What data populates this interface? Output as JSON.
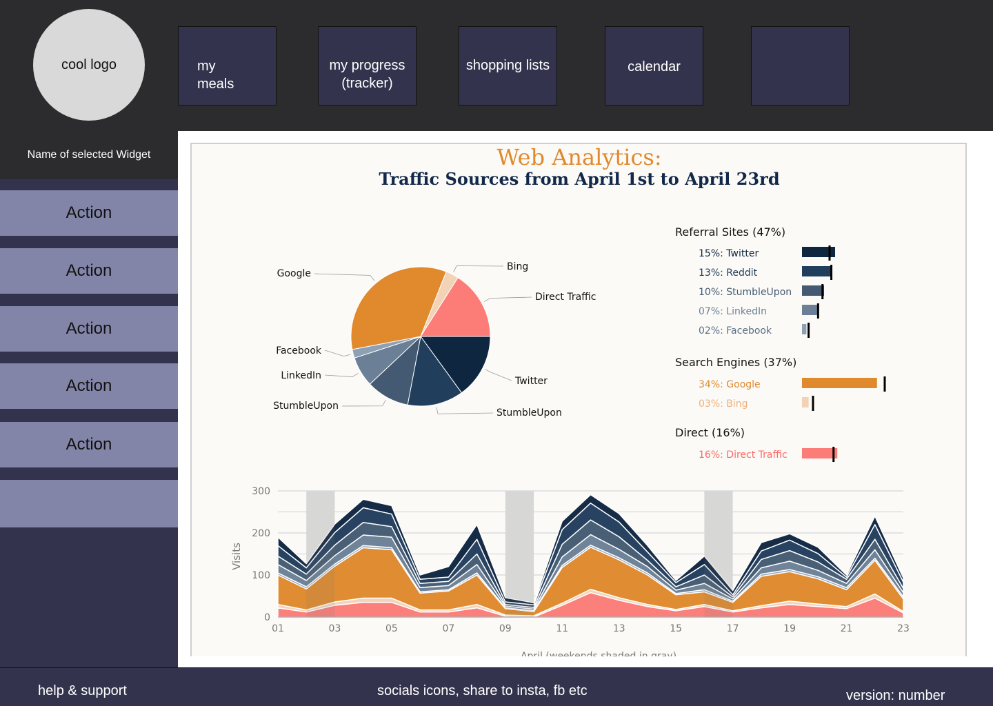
{
  "header": {
    "logo_text": "cool logo",
    "nav": [
      {
        "label": "my\nmeals"
      },
      {
        "label": "my progress\n(tracker)"
      },
      {
        "label": "shopping lists"
      },
      {
        "label": "calendar"
      },
      {
        "label": ""
      }
    ]
  },
  "sidebar": {
    "widget_name": "Name of selected Widget",
    "actions": [
      "Action",
      "Action",
      "Action",
      "Action",
      "Action"
    ]
  },
  "colors": {
    "twitter": "#0f2641",
    "reddit": "#213e5d",
    "stumbleupon": "#445a72",
    "linkedin": "#6b8096",
    "facebook": "#8ea0b4",
    "google": "#e0892d",
    "bing": "#f3d3b6",
    "direct": "#fc7c78"
  },
  "chart_data": [
    {
      "type": "pie",
      "title": "Web Analytics:",
      "subtitle": "Traffic Sources from April 1st to April 23rd",
      "slices": [
        {
          "label": "Twitter",
          "value": 15,
          "color": "#0f2641"
        },
        {
          "label": "StumbleUpon",
          "value": 13,
          "color": "#213e5d"
        },
        {
          "label": "StumbleUpon",
          "value": 10,
          "color": "#445a72"
        },
        {
          "label": "LinkedIn",
          "value": 7,
          "color": "#6b8096"
        },
        {
          "label": "Facebook",
          "value": 2,
          "color": "#8ea0b4"
        },
        {
          "label": "Google",
          "value": 34,
          "color": "#e0892d"
        },
        {
          "label": "Bing",
          "value": 3,
          "color": "#f3d3b6"
        },
        {
          "label": "Direct Traffic",
          "value": 16,
          "color": "#fc7c78"
        }
      ]
    },
    {
      "type": "bar",
      "groups": [
        {
          "title": "Referral Sites (47%)",
          "items": [
            {
              "label": "15%: Twitter",
              "value": 15,
              "target": 12.5,
              "color": "#0f2641"
            },
            {
              "label": "13%: Reddit",
              "value": 13,
              "target": 13.3,
              "color": "#213e5d"
            },
            {
              "label": "10%: StumbleUpon",
              "value": 10,
              "target": 9.3,
              "color": "#445a72"
            },
            {
              "label": "07%: LinkedIn",
              "value": 7,
              "target": 7.3,
              "color": "#6b8096"
            },
            {
              "label": "02%: Facebook",
              "value": 2,
              "target": 3,
              "color": "#8ea0b4"
            }
          ]
        },
        {
          "title": "Search Engines (37%)",
          "items": [
            {
              "label": "34%: Google",
              "value": 34,
              "target": 37.5,
              "color": "#e0892d"
            },
            {
              "label": "03%: Bing",
              "value": 3,
              "target": 5,
              "color": "#f3d3b6"
            }
          ]
        },
        {
          "title": "Direct (16%)",
          "items": [
            {
              "label": "16%: Direct Traffic",
              "value": 16,
              "target": 14.3,
              "color": "#fc7c78"
            }
          ]
        }
      ]
    },
    {
      "type": "area",
      "ylabel": "Visits",
      "xlabel": "April (weekends shaded in gray)",
      "ylim": [
        0,
        300
      ],
      "yticks": [
        0,
        100,
        200,
        300
      ],
      "xticks": [
        "01",
        "03",
        "05",
        "07",
        "09",
        "11",
        "13",
        "15",
        "17",
        "19",
        "21",
        "23"
      ],
      "x": [
        1,
        2,
        3,
        4,
        5,
        6,
        7,
        8,
        9,
        10,
        11,
        12,
        13,
        14,
        15,
        16,
        17,
        18,
        19,
        20,
        21,
        22,
        23
      ],
      "weekends": [
        [
          2,
          3
        ],
        [
          9,
          10
        ],
        [
          16,
          17
        ]
      ],
      "series": [
        {
          "name": "Direct Traffic",
          "color": "#fc7c78",
          "values": [
            22,
            12,
            28,
            35,
            35,
            12,
            12,
            22,
            2,
            0,
            28,
            58,
            40,
            25,
            15,
            25,
            12,
            22,
            30,
            25,
            20,
            45,
            10
          ]
        },
        {
          "name": "Bing",
          "color": "#f3d3b6",
          "values": [
            8,
            5,
            8,
            10,
            10,
            5,
            5,
            8,
            3,
            3,
            5,
            8,
            6,
            5,
            3,
            5,
            3,
            5,
            8,
            6,
            5,
            10,
            3
          ]
        },
        {
          "name": "Google",
          "color": "#e0892d",
          "values": [
            70,
            50,
            85,
            120,
            115,
            40,
            45,
            70,
            15,
            10,
            85,
            100,
            90,
            70,
            35,
            30,
            20,
            70,
            70,
            60,
            40,
            80,
            30
          ]
        },
        {
          "name": "Facebook",
          "color": "#8ea0b4",
          "values": [
            5,
            5,
            5,
            5,
            5,
            3,
            3,
            5,
            2,
            2,
            5,
            5,
            5,
            5,
            3,
            5,
            3,
            5,
            5,
            5,
            5,
            5,
            5
          ]
        },
        {
          "name": "LinkedIn",
          "color": "#6b8096",
          "values": [
            20,
            15,
            20,
            25,
            25,
            10,
            10,
            20,
            4,
            4,
            20,
            25,
            20,
            15,
            8,
            15,
            5,
            15,
            20,
            15,
            10,
            20,
            10
          ]
        },
        {
          "name": "StumbleUpon",
          "color": "#445a72",
          "values": [
            20,
            15,
            25,
            30,
            25,
            10,
            10,
            25,
            4,
            4,
            30,
            35,
            30,
            15,
            8,
            20,
            5,
            20,
            25,
            20,
            10,
            25,
            10
          ]
        },
        {
          "name": "Reddit",
          "color": "#213e5d",
          "values": [
            25,
            15,
            30,
            35,
            30,
            10,
            10,
            35,
            6,
            6,
            35,
            40,
            35,
            20,
            10,
            25,
            5,
            20,
            25,
            20,
            5,
            35,
            15
          ]
        },
        {
          "name": "Twitter",
          "color": "#0f2641",
          "values": [
            20,
            10,
            20,
            20,
            20,
            10,
            25,
            35,
            10,
            5,
            20,
            20,
            20,
            15,
            5,
            20,
            10,
            20,
            15,
            15,
            5,
            20,
            10
          ]
        }
      ]
    }
  ],
  "footer": {
    "help": "help & support",
    "socials": "socials icons, share to insta, fb etc",
    "version": "version: number"
  }
}
